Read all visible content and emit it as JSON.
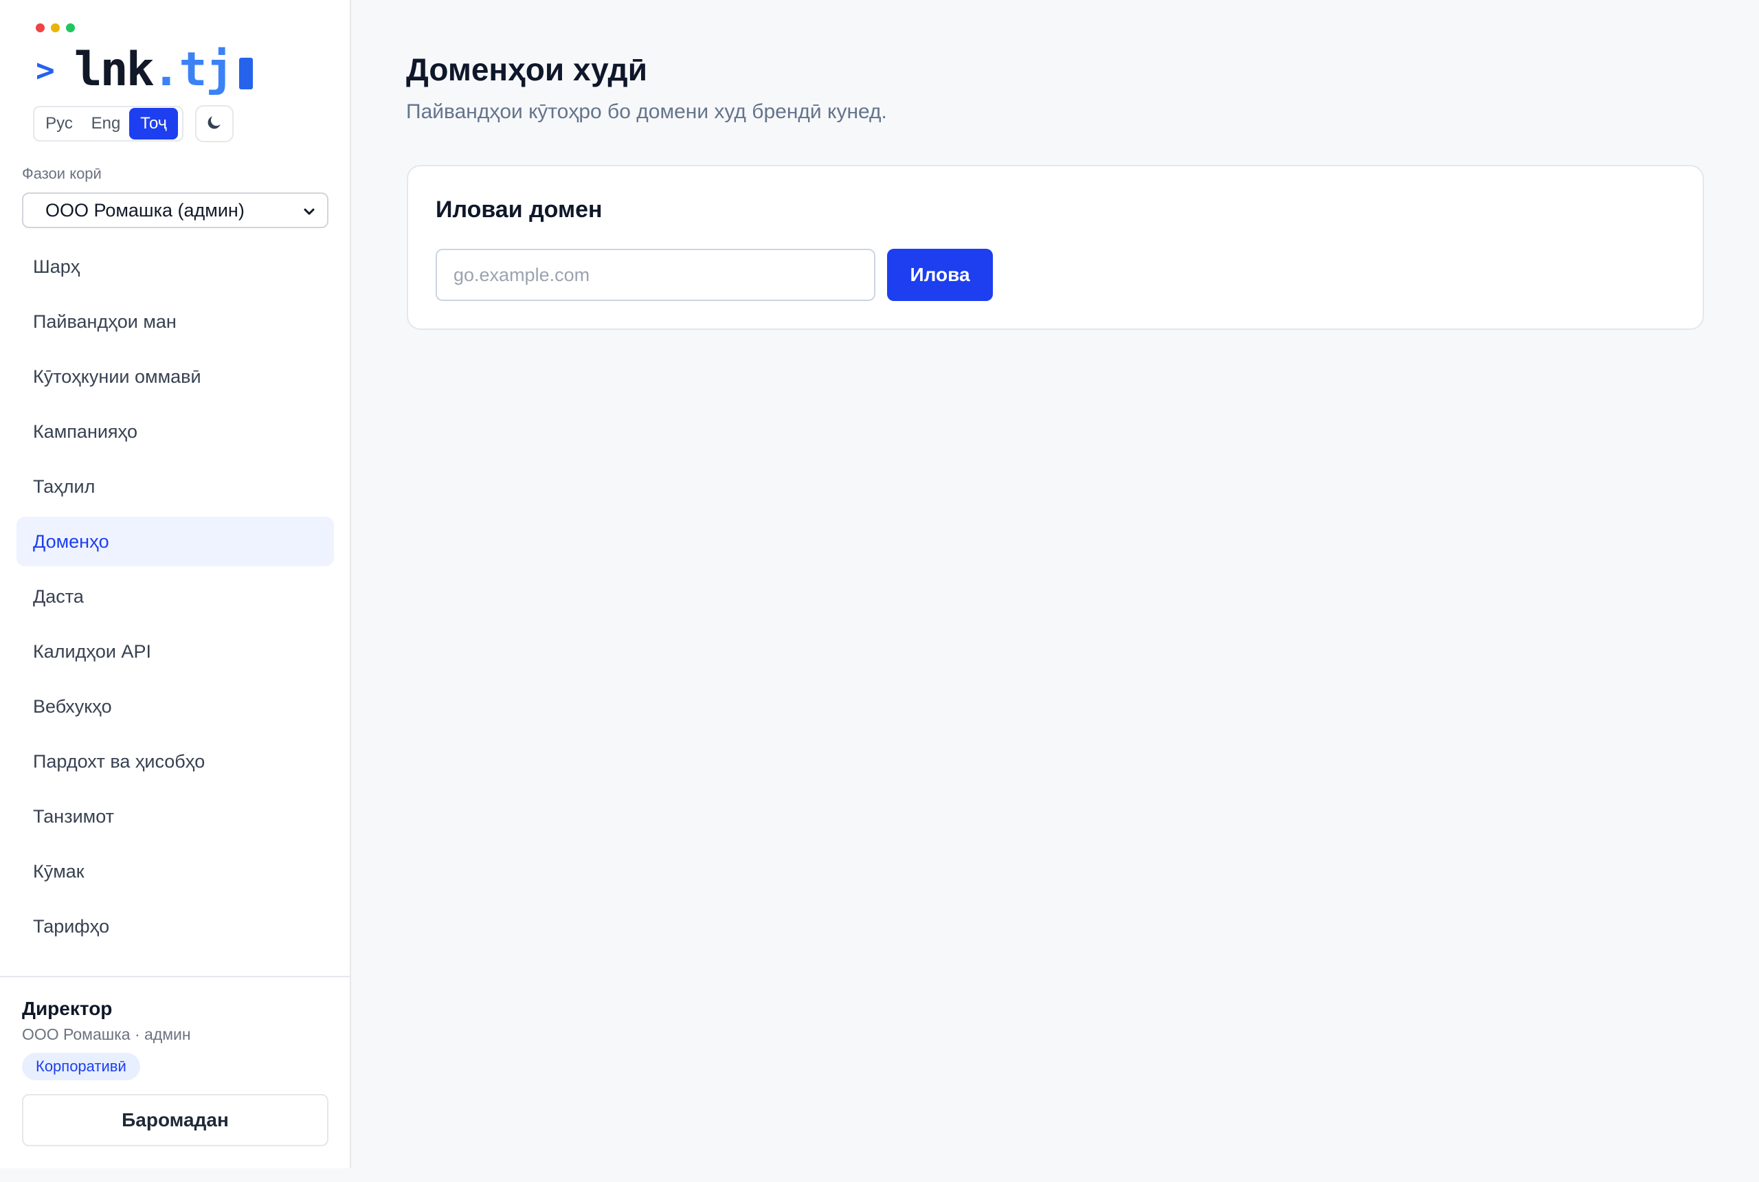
{
  "brand": {
    "prompt": ">",
    "name": "lnk",
    "tld": ".tj",
    "window_dots": [
      "#ef4444",
      "#eab308",
      "#22c55e"
    ],
    "accent": "#1d3ff0"
  },
  "lang_switch": {
    "options": [
      "Рус",
      "Eng",
      "Тоҷ"
    ],
    "selected": "Тоҷ"
  },
  "theme_toggle": {
    "icon": "moon-icon"
  },
  "workspace": {
    "label": "Фазои корӣ",
    "selected": "ООО Ромашка (админ)"
  },
  "nav": {
    "items": [
      {
        "label": "Шарҳ",
        "active": false
      },
      {
        "label": "Пайвандҳои ман",
        "active": false
      },
      {
        "label": "Кӯтоҳкунии оммавӣ",
        "active": false
      },
      {
        "label": "Кампанияҳо",
        "active": false
      },
      {
        "label": "Таҳлил",
        "active": false
      },
      {
        "label": "Доменҳо",
        "active": true
      },
      {
        "label": "Даста",
        "active": false
      },
      {
        "label": "Калидҳои API",
        "active": false
      },
      {
        "label": "Вебхукҳо",
        "active": false
      },
      {
        "label": "Пардохт ва ҳисобҳо",
        "active": false
      },
      {
        "label": "Танзимот",
        "active": false
      },
      {
        "label": "Кӯмак",
        "active": false
      },
      {
        "label": "Тарифҳо",
        "active": false
      }
    ]
  },
  "user": {
    "name": "Директор",
    "org": "ООО Ромашка · админ",
    "plan": "Корпоративӣ",
    "logout_label": "Баромадан"
  },
  "main": {
    "title": "Доменҳои худӣ",
    "subtitle": "Пайвандҳои кӯтоҳро бо домени худ брендӣ кунед.",
    "add_card": {
      "title": "Иловаи домен",
      "input_value": "",
      "input_placeholder": "go.example.com",
      "button_label": "Илова"
    }
  }
}
